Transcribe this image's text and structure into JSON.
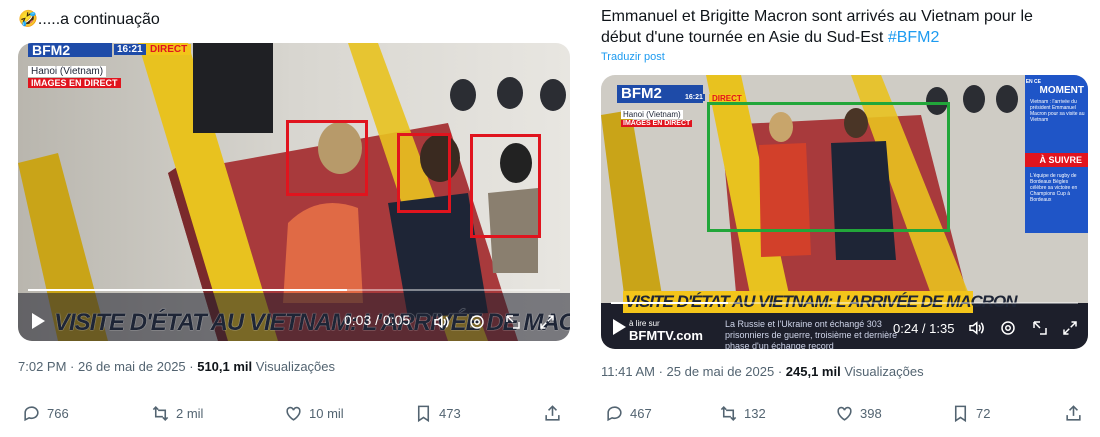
{
  "left_post": {
    "emoji": "🤣",
    "text": ".....a continuação",
    "video": {
      "channel": "BFM2",
      "clock": "16:21",
      "live_tag": "DIRECT",
      "location": "Hanoi (Vietnam)",
      "live_images": "IMAGES EN DIRECT",
      "chyron": "VISITE D'ÉTAT AU VIETNAM: L'ARRIVÉE DE MACRON",
      "time": "0:03 / 0:05",
      "progress": 0.6,
      "highlight_color": "#e0141e"
    },
    "meta_time": "7:02 PM · 26 de mai de 2025 · ",
    "views_count": "510,1 mil",
    "views_label": " Visualizações",
    "actions": {
      "replies": "766",
      "reposts": "2 mil",
      "likes": "10 mil",
      "bookmarks": "473"
    }
  },
  "right_post": {
    "text": "Emmanuel et Brigitte Macron sont arrivés au Vietnam pour le début d'une tournée en Asie du Sud-Est ",
    "hashtag": "#BFM2",
    "translate": "Traduzir post",
    "video": {
      "channel": "BFM2",
      "clock": "16:21",
      "live_tag": "DIRECT",
      "location": "Hanoi (Vietnam)",
      "live_images": "IMAGES EN DIRECT",
      "sidebar_now_label": "EN CE",
      "sidebar_now_title": "MOMENT",
      "sidebar_now_text": "Vietnam : l'arrivée du président Emmanuel Macron pour sa visite au Vietnam",
      "sidebar_next_title": "À SUIVRE",
      "sidebar_next_text": "L'équipe de rugby de Bordeaux Bègles célèbre sa victoire en Champions Cup à Bordeaux",
      "chyron": "VISITE D'ÉTAT AU VIETNAM: L'ARRIVÉE DE MACRON",
      "footer_site_label": "à lire sur",
      "footer_site": "BFMTV.com",
      "ticker": "La Russie et l'Ukraine ont échangé 303 prisonniers de guerre, troisième et dernière phase d'un échange record",
      "time": "0:24 / 1:35",
      "progress": 0.25,
      "highlight_color": "#22a63a"
    },
    "meta_time": "11:41 AM · 25 de mai de 2025 · ",
    "views_count": "245,1 mil",
    "views_label": " Visualizações",
    "actions": {
      "replies": "467",
      "reposts": "132",
      "likes": "398",
      "bookmarks": "72"
    }
  },
  "icons": [
    "reply-icon",
    "repost-icon",
    "like-icon",
    "bookmark-icon",
    "share-icon",
    "play-icon",
    "volume-icon",
    "settings-icon",
    "dock-icon",
    "fullscreen-icon"
  ]
}
